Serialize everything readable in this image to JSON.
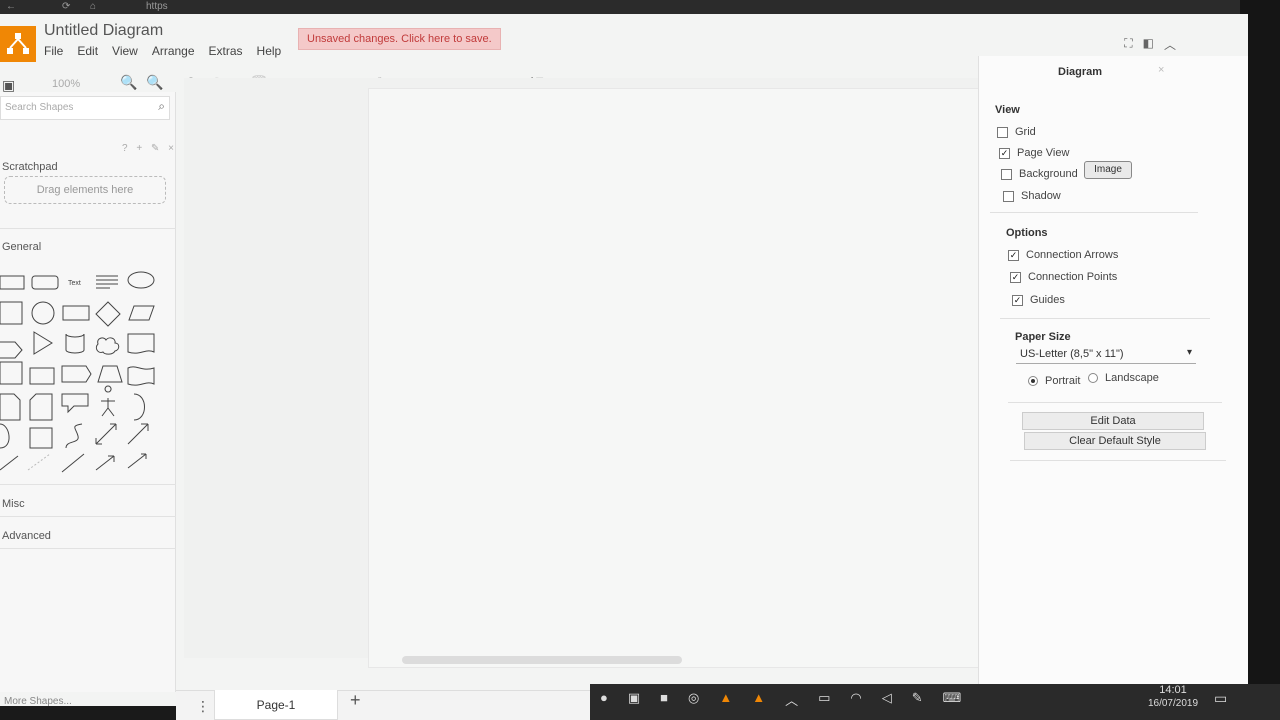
{
  "browser": {
    "tab_text": "https"
  },
  "app": {
    "title": "Untitled Diagram",
    "menu": [
      "File",
      "Edit",
      "View",
      "Arrange",
      "Extras",
      "Help"
    ],
    "unsaved_notice": "Unsaved changes. Click here to save.",
    "zoom_label": "100%"
  },
  "sidebar": {
    "search_placeholder": "Search Shapes",
    "scratchpad_title": "Scratchpad",
    "scratchpad_icons": "? + ✎ ×",
    "dropzone_label": "Drag elements here",
    "general_title": "General",
    "text_shape_label": "Text",
    "misc_title": "Misc",
    "advanced_title": "Advanced",
    "more_shapes": "More Shapes..."
  },
  "panel": {
    "title": "Diagram",
    "view_heading": "View",
    "view_options": [
      {
        "label": "Grid",
        "checked": false
      },
      {
        "label": "Page View",
        "checked": true
      },
      {
        "label": "Background",
        "checked": false
      },
      {
        "label": "Shadow",
        "checked": false
      }
    ],
    "image_button": "Image",
    "options_heading": "Options",
    "options": [
      {
        "label": "Connection Arrows",
        "checked": true
      },
      {
        "label": "Connection Points",
        "checked": true
      },
      {
        "label": "Guides",
        "checked": true
      }
    ],
    "paper_heading": "Paper Size",
    "paper_value": "US-Letter (8,5\" x 11\")",
    "portrait_label": "Portrait",
    "landscape_label": "Landscape",
    "orientation": "Portrait",
    "edit_data_button": "Edit Data",
    "clear_style_button": "Clear Default Style"
  },
  "tabs": {
    "page_label": "Page-1",
    "add_label": "+"
  },
  "taskbar": {
    "time": "14:01",
    "date": "16/07/2019"
  },
  "colors": {
    "logo": "#f08705",
    "unsaved_bg": "#f4c9c9",
    "unsaved_text": "#c13b3b"
  }
}
